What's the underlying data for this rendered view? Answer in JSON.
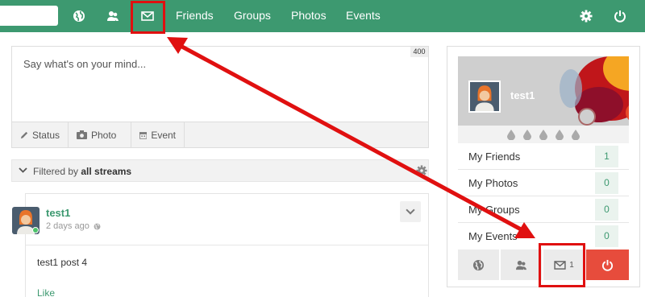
{
  "topbar": {
    "search_placeholder": "",
    "nav_links": [
      "Friends",
      "Groups",
      "Photos",
      "Events"
    ]
  },
  "composer": {
    "placeholder": "Say what's on your mind...",
    "char_limit": "400",
    "tabs": [
      "Status",
      "Photo",
      "Event"
    ]
  },
  "filter": {
    "prefix": "Filtered by",
    "value": "all streams"
  },
  "post": {
    "author": "test1",
    "time": "2 days ago",
    "body": "test1 post 4",
    "like_label": "Like"
  },
  "profile": {
    "name": "test1",
    "stats": [
      {
        "label": "My Friends",
        "count": "1"
      },
      {
        "label": "My Photos",
        "count": "0"
      },
      {
        "label": "My Groups",
        "count": "0"
      },
      {
        "label": "My Events",
        "count": "0"
      }
    ],
    "messages_badge": "1"
  },
  "colors": {
    "brand_green": "#3d9970",
    "danger_red": "#e74c3c",
    "annotation_red": "#e01010"
  },
  "icons": [
    "globe-icon",
    "friends-icon",
    "mail-icon",
    "gear-icon",
    "power-icon",
    "pencil-icon",
    "camera-icon",
    "calendar-icon",
    "chevron-down-icon",
    "water-drop-icon"
  ]
}
